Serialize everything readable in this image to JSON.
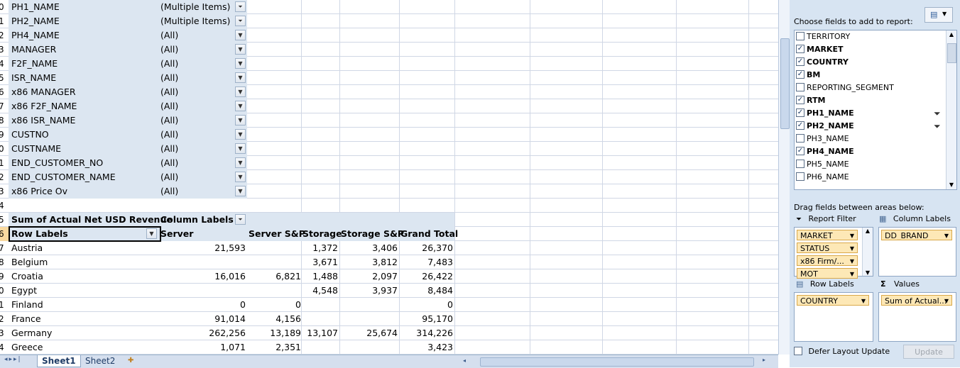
{
  "filters": [
    {
      "row": "0",
      "field": "PH1_NAME",
      "value": "(Multiple Items)",
      "filtered": true
    },
    {
      "row": "1",
      "field": "PH2_NAME",
      "value": "(Multiple Items)",
      "filtered": true
    },
    {
      "row": "2",
      "field": "PH4_NAME",
      "value": "(All)",
      "filtered": false
    },
    {
      "row": "3",
      "field": "MANAGER",
      "value": "(All)",
      "filtered": false
    },
    {
      "row": "4",
      "field": "F2F_NAME",
      "value": "(All)",
      "filtered": false
    },
    {
      "row": "5",
      "field": "ISR_NAME",
      "value": "(All)",
      "filtered": false
    },
    {
      "row": "6",
      "field": "x86 MANAGER",
      "value": "(All)",
      "filtered": false
    },
    {
      "row": "7",
      "field": "x86 F2F_NAME",
      "value": "(All)",
      "filtered": false
    },
    {
      "row": "8",
      "field": "x86 ISR_NAME",
      "value": "(All)",
      "filtered": false
    },
    {
      "row": "9",
      "field": "CUSTNO",
      "value": "(All)",
      "filtered": false
    },
    {
      "row": "0",
      "field": "CUSTNAME",
      "value": "(All)",
      "filtered": false
    },
    {
      "row": "1",
      "field": "END_CUSTOMER_NO",
      "value": "(All)",
      "filtered": false
    },
    {
      "row": "2",
      "field": "END_CUSTOMER_NAME",
      "value": "(All)",
      "filtered": false
    },
    {
      "row": "3",
      "field": "x86 Price Ov",
      "value": "(All)",
      "filtered": false
    }
  ],
  "empty_row_num": "4",
  "pivot": {
    "value_row_num": "5",
    "value_label": "Sum of Actual Net USD Revenue",
    "column_labels": "Column Labels",
    "header_row_num": "6",
    "row_labels": "Row Labels",
    "columns": [
      "Server",
      "Server S&P",
      "Storage",
      "Storage S&P",
      "Grand Total"
    ],
    "rows": [
      {
        "num": "7",
        "label": "Austria",
        "values": [
          "21,593",
          "",
          "1,372",
          "3,406",
          "26,370"
        ]
      },
      {
        "num": "8",
        "label": "Belgium",
        "values": [
          "",
          "",
          "3,671",
          "3,812",
          "7,483"
        ]
      },
      {
        "num": "9",
        "label": "Croatia",
        "values": [
          "16,016",
          "6,821",
          "1,488",
          "2,097",
          "26,422"
        ]
      },
      {
        "num": "0",
        "label": "Egypt",
        "values": [
          "",
          "",
          "4,548",
          "3,937",
          "8,484"
        ]
      },
      {
        "num": "1",
        "label": "Finland",
        "values": [
          "0",
          "0",
          "",
          "",
          "0"
        ]
      },
      {
        "num": "2",
        "label": "France",
        "values": [
          "91,014",
          "4,156",
          "",
          "",
          "95,170"
        ]
      },
      {
        "num": "3",
        "label": "Germany",
        "values": [
          "262,256",
          "13,189",
          "13,107",
          "25,674",
          "314,226"
        ]
      },
      {
        "num": "4",
        "label": "Greece",
        "values": [
          "1,071",
          "2,351",
          "",
          "",
          "3,423"
        ]
      }
    ]
  },
  "tabs": [
    "Sheet1",
    "Sheet2"
  ],
  "fieldlist": {
    "choose_label": "Choose fields to add to report:",
    "fields": [
      {
        "name": "TERRITORY",
        "checked": false,
        "filter": false
      },
      {
        "name": "MARKET",
        "checked": true,
        "filter": false
      },
      {
        "name": "COUNTRY",
        "checked": true,
        "filter": false
      },
      {
        "name": "BM",
        "checked": true,
        "filter": false
      },
      {
        "name": "REPORTING_SEGMENT",
        "checked": false,
        "filter": false
      },
      {
        "name": "RTM",
        "checked": true,
        "filter": false
      },
      {
        "name": "PH1_NAME",
        "checked": true,
        "filter": true
      },
      {
        "name": "PH2_NAME",
        "checked": true,
        "filter": true
      },
      {
        "name": "PH3_NAME",
        "checked": false,
        "filter": false
      },
      {
        "name": "PH4_NAME",
        "checked": true,
        "filter": false
      },
      {
        "name": "PH5_NAME",
        "checked": false,
        "filter": false
      },
      {
        "name": "PH6_NAME",
        "checked": false,
        "filter": false
      }
    ],
    "drag_label": "Drag fields between areas below:",
    "report_filter_label": "Report Filter",
    "column_labels_label": "Column Labels",
    "row_labels_label": "Row Labels",
    "values_label": "Values",
    "report_filter_items": [
      "MARKET",
      "STATUS",
      "x86 Firm/...",
      "MOT"
    ],
    "column_items": [
      "DD_BRAND"
    ],
    "row_items": [
      "COUNTRY"
    ],
    "value_items": [
      "Sum of Actual..."
    ],
    "defer_label": "Defer Layout Update",
    "update_label": "Update"
  }
}
